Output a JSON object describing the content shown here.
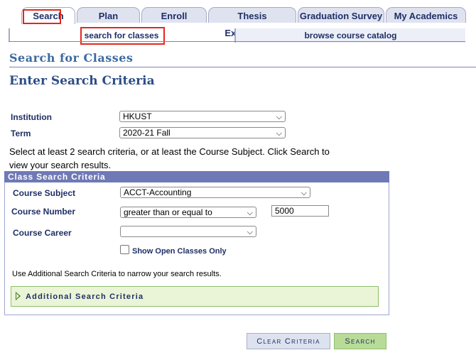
{
  "tabs": [
    {
      "label": "Search"
    },
    {
      "label": "Plan"
    },
    {
      "label": "Enroll"
    },
    {
      "label": "Thesis Examination"
    },
    {
      "label": "Graduation Survey"
    },
    {
      "label": "My Academics"
    }
  ],
  "subtabs": [
    {
      "label": "search for classes"
    },
    {
      "label": "browse course catalog"
    }
  ],
  "page_title": "Search for Classes",
  "section_title": "Enter Search Criteria",
  "institution": {
    "label": "Institution",
    "value": "HKUST"
  },
  "term": {
    "label": "Term",
    "value": "2020-21 Fall"
  },
  "instruction": "Select at least 2 search criteria, or at least the Course Subject. Click Search to view your search results.",
  "criteria_panel": {
    "title": "Class Search Criteria",
    "course_subject": {
      "label": "Course Subject",
      "value": "ACCT-Accounting"
    },
    "course_number": {
      "label": "Course Number",
      "operator": "greater than or equal to",
      "value": "5000"
    },
    "course_career": {
      "label": "Course Career",
      "value": ""
    },
    "open_only": {
      "label": "Show Open Classes Only",
      "checked": false
    },
    "hint": "Use Additional Search Criteria to narrow your search results.",
    "additional": "Additional Search Criteria"
  },
  "buttons": {
    "clear": "Clear Criteria",
    "search": "Search"
  },
  "colors": {
    "highlight": "#e0291f",
    "navy": "#1f2f66",
    "panel": "#6f79b6",
    "green": "#b8dc98"
  }
}
